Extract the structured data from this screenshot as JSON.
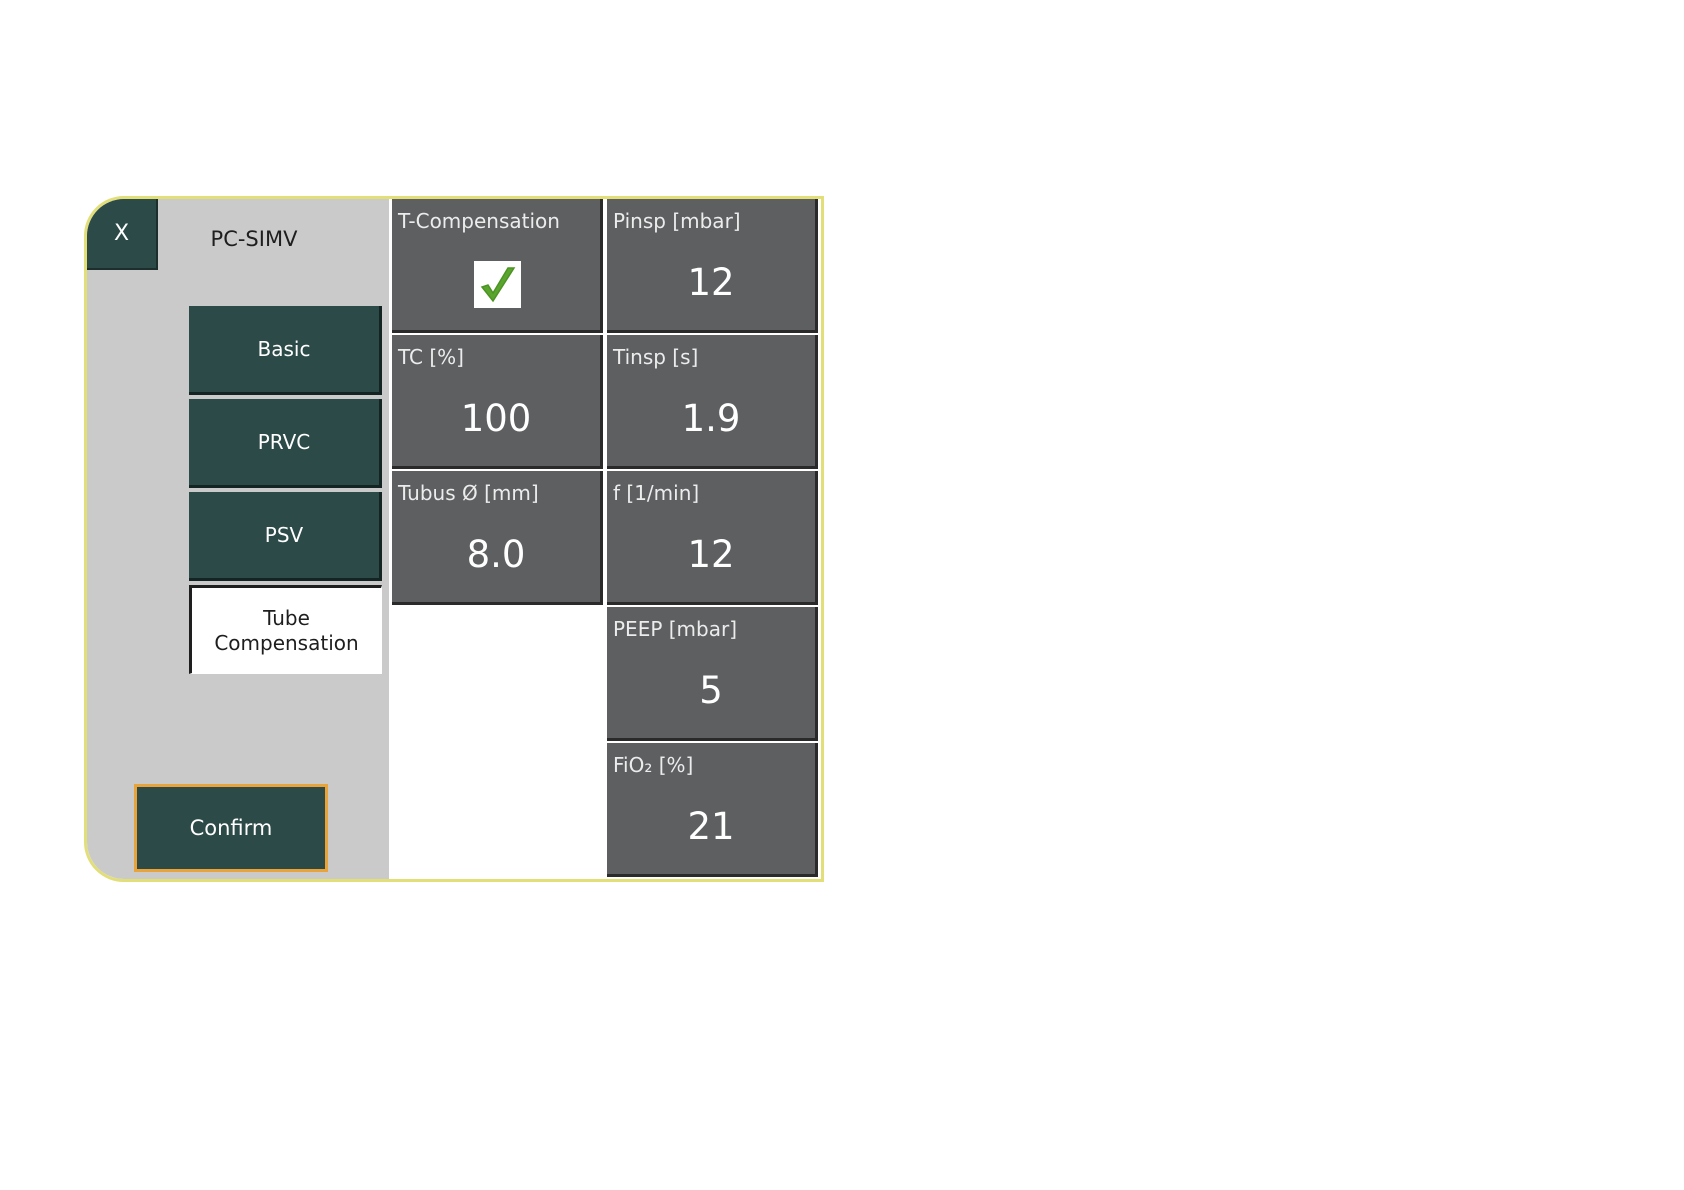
{
  "header": {
    "close_label": "X",
    "mode_title": "PC-SIMV"
  },
  "nav": {
    "items": [
      {
        "label": "Basic",
        "active": false
      },
      {
        "label": "PRVC",
        "active": false
      },
      {
        "label": "PSV",
        "active": false
      },
      {
        "label": "Tube\nCompensation",
        "active": true
      }
    ]
  },
  "confirm_label": "Confirm",
  "settings": {
    "t_compensation": {
      "label": "T-Compensation",
      "checked": true,
      "icon": "checkmark-icon",
      "check_color": "#5aa52d"
    },
    "tc": {
      "label": "TC [%]",
      "value": "100"
    },
    "tubus": {
      "label": "Tubus Ø [mm]",
      "value": "8.0"
    },
    "pinsp": {
      "label": "Pinsp [mbar]",
      "value": "12"
    },
    "tinsp": {
      "label": "Tinsp [s]",
      "value": "1.9"
    },
    "f": {
      "label": "f [1/min]",
      "value": "12"
    },
    "peep": {
      "label": "PEEP [mbar]",
      "value": "5"
    },
    "fio2": {
      "label": "FiO₂ [%]",
      "value": "21"
    }
  },
  "colors": {
    "button_dark": "#2b4a48",
    "tile_gray": "#5d5f61",
    "panel_border": "#e2de78",
    "confirm_border": "#e8a33a"
  }
}
